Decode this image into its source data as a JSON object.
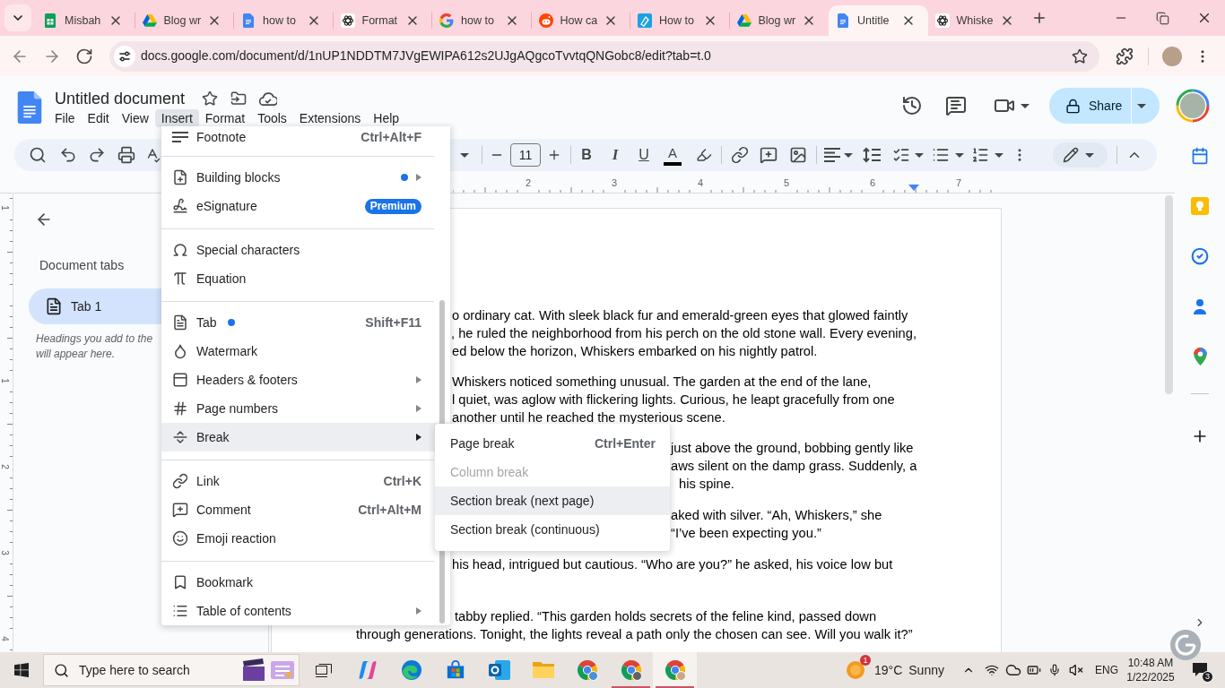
{
  "browser": {
    "tabs": [
      {
        "title": "Misbah",
        "selected": false
      },
      {
        "title": "Blog wr",
        "selected": false
      },
      {
        "title": "how to",
        "selected": false
      },
      {
        "title": "Format",
        "selected": false
      },
      {
        "title": "how to",
        "selected": false
      },
      {
        "title": "How ca",
        "selected": false
      },
      {
        "title": "How to",
        "selected": false
      },
      {
        "title": "Blog wr",
        "selected": false
      },
      {
        "title": "Untitle",
        "selected": true
      },
      {
        "title": "Whiske",
        "selected": false
      }
    ],
    "address": "docs.google.com/document/d/1nUP1NDDTM7JVgEWIPA612s2UJgAQgcoTvvtqQNGobc8/edit?tab=t.0"
  },
  "docs": {
    "title": "Untitled document",
    "menubar": [
      {
        "label": "File",
        "selected": false
      },
      {
        "label": "Edit",
        "selected": false
      },
      {
        "label": "View",
        "selected": false
      },
      {
        "label": "Insert",
        "selected": true
      },
      {
        "label": "Format",
        "selected": false
      },
      {
        "label": "Tools",
        "selected": false
      },
      {
        "label": "Extensions",
        "selected": false
      },
      {
        "label": "Help",
        "selected": false
      }
    ],
    "share": {
      "label": "Share"
    },
    "toolbar": {
      "font_size": "11",
      "bold": "B",
      "italic": "I",
      "underline": "U",
      "text_color": "A"
    },
    "ruler": {
      "numbers": [
        "2",
        "3",
        "4",
        "5",
        "6",
        "7"
      ]
    },
    "vertical_ruler": {
      "numbers": [
        "1",
        "1",
        "2",
        "3",
        "4"
      ]
    },
    "sidebar": {
      "heading": "Document tabs",
      "tabs": [
        {
          "label": "Tab 1",
          "selected": true
        }
      ],
      "hint_lines": [
        "Headings you add to the",
        "will appear here."
      ]
    },
    "page": {
      "paragraphs": [
        {
          "lines": [
            "o ordinary cat. With sleek black fur and emerald-green eyes that glowed faintly",
            ", he ruled the neighborhood from his perch on the old stone wall. Every evening,",
            "ed below the horizon, Whiskers embarked on his nightly patrol."
          ]
        },
        {
          "lines": [
            "Whiskers noticed something unusual. The garden at the end of the lane,",
            "l quiet, was aglow with flickering lights. Curious, he leapt gracefully from one",
            "another until he reached the mysterious scene."
          ]
        },
        {
          "lines": [
            "just above the ground, bobbing gently like",
            "aws silent on the damp grass. Suddenly, a",
            "his spine."
          ]
        },
        {
          "lines": [
            "aked with silver. “Ah, Whiskers,” she",
            "“I’ve been expecting you.”"
          ]
        },
        {
          "lines": [
            "his head, intrigued but cautious. “Who are you?” he asked, his voice low but"
          ]
        },
        {
          "lines": [
            "tabby replied. “This garden holds secrets of the feline kind, passed down",
            "through generations. Tonight, the lights reveal a path only the chosen can see. Will you walk it?”"
          ]
        }
      ]
    },
    "insert_menu": {
      "items": [
        {
          "kind": "item",
          "label": "Footnote",
          "shortcut": "Ctrl+Alt+F",
          "new": false,
          "submenu": false,
          "selected": false
        },
        {
          "kind": "separator"
        },
        {
          "kind": "item",
          "label": "Building blocks",
          "new": true,
          "submenu": true,
          "selected": false
        },
        {
          "kind": "item",
          "label": "eSignature",
          "badge": "Premium",
          "new": false,
          "submenu": false,
          "selected": false
        },
        {
          "kind": "separator"
        },
        {
          "kind": "item",
          "label": "Special characters",
          "new": false,
          "submenu": false,
          "selected": false
        },
        {
          "kind": "item",
          "label": "Equation",
          "new": false,
          "submenu": false,
          "selected": false
        },
        {
          "kind": "separator"
        },
        {
          "kind": "item",
          "label": "Tab",
          "shortcut": "Shift+F11",
          "new": true,
          "submenu": false,
          "selected": false
        },
        {
          "kind": "item",
          "label": "Watermark",
          "new": false,
          "submenu": false,
          "selected": false
        },
        {
          "kind": "item",
          "label": "Headers & footers",
          "new": false,
          "submenu": true,
          "selected": false
        },
        {
          "kind": "item",
          "label": "Page numbers",
          "new": false,
          "submenu": true,
          "selected": false
        },
        {
          "kind": "item",
          "label": "Break",
          "new": false,
          "submenu": true,
          "selected": true
        },
        {
          "kind": "separator"
        },
        {
          "kind": "item",
          "label": "Link",
          "shortcut": "Ctrl+K",
          "new": false,
          "submenu": false,
          "selected": false
        },
        {
          "kind": "item",
          "label": "Comment",
          "shortcut": "Ctrl+Alt+M",
          "new": false,
          "submenu": false,
          "selected": false
        },
        {
          "kind": "item",
          "label": "Emoji reaction",
          "new": false,
          "submenu": false,
          "selected": false
        },
        {
          "kind": "separator"
        },
        {
          "kind": "item",
          "label": "Bookmark",
          "new": false,
          "submenu": false,
          "selected": false
        },
        {
          "kind": "item",
          "label": "Table of contents",
          "new": false,
          "submenu": true,
          "selected": false
        }
      ]
    },
    "break_submenu": {
      "items": [
        {
          "label": "Page break",
          "shortcut": "Ctrl+Enter",
          "disabled": false,
          "selected": false
        },
        {
          "label": "Column break",
          "disabled": true,
          "selected": false
        },
        {
          "label": "Section break (next page)",
          "disabled": false,
          "selected": true
        },
        {
          "label": "Section break (continuous)",
          "disabled": false,
          "selected": false
        }
      ]
    }
  },
  "taskbar": {
    "search_placeholder": "Type here to search",
    "apps": [
      {
        "running": false,
        "selected": false
      },
      {
        "running": false,
        "selected": false
      },
      {
        "running": false,
        "selected": false
      },
      {
        "running": false,
        "selected": false
      },
      {
        "running": false,
        "selected": false
      },
      {
        "running": false,
        "selected": false
      },
      {
        "running": true,
        "selected": false
      },
      {
        "running": true,
        "selected": true
      }
    ],
    "weather": {
      "alert_count": "1",
      "temperature": "19°C",
      "condition": "Sunny"
    },
    "language": "ENG",
    "time": "10:48 AM",
    "date": "1/22/2025",
    "notification_count": "3"
  }
}
